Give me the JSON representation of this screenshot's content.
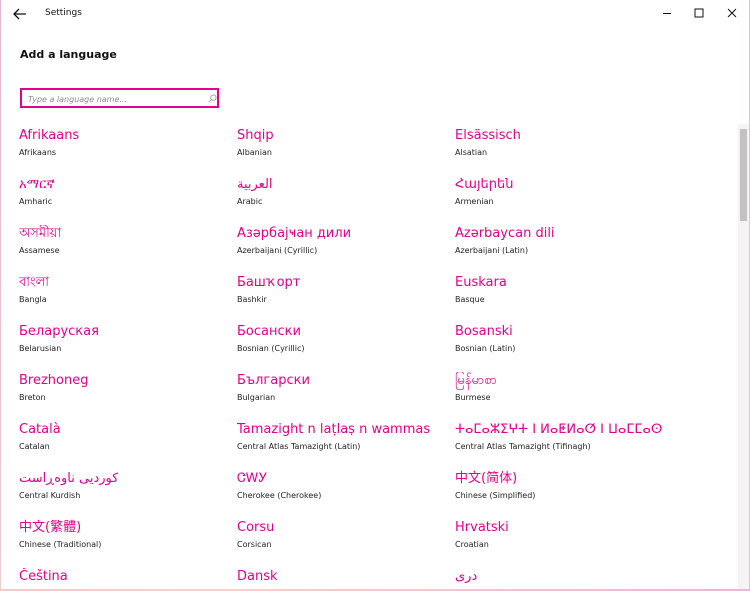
{
  "window": {
    "title": "Settings"
  },
  "page": {
    "title": "Add a language"
  },
  "search": {
    "placeholder": "Type a language name..."
  },
  "languages": [
    {
      "native": "Afrikaans",
      "english": "Afrikaans"
    },
    {
      "native": "Shqip",
      "english": "Albanian"
    },
    {
      "native": "Elsässisch",
      "english": "Alsatian"
    },
    {
      "native": "አማርኛ",
      "english": "Amharic"
    },
    {
      "native": "العربية",
      "english": "Arabic"
    },
    {
      "native": "Հայերեն",
      "english": "Armenian"
    },
    {
      "native": "অসমীয়া",
      "english": "Assamese"
    },
    {
      "native": "Азәрбајҹан дили",
      "english": "Azerbaijani (Cyrillic)"
    },
    {
      "native": "Azərbaycan dili",
      "english": "Azerbaijani (Latin)"
    },
    {
      "native": "বাংলা",
      "english": "Bangla"
    },
    {
      "native": "Башҡорт",
      "english": "Bashkir"
    },
    {
      "native": "Euskara",
      "english": "Basque"
    },
    {
      "native": "Беларуская",
      "english": "Belarusian"
    },
    {
      "native": "Босански",
      "english": "Bosnian (Cyrillic)"
    },
    {
      "native": "Bosanski",
      "english": "Bosnian (Latin)"
    },
    {
      "native": "Brezhoneg",
      "english": "Breton"
    },
    {
      "native": "Български",
      "english": "Bulgarian"
    },
    {
      "native": "မြန်မာစာ",
      "english": "Burmese"
    },
    {
      "native": "Català",
      "english": "Catalan"
    },
    {
      "native": "Tamazight n laṭlaṣ n wammas",
      "english": "Central Atlas Tamazight (Latin)"
    },
    {
      "native": "ⵜⴰⵎⴰⵣⵉⵖⵜ ⵏ ⵍⴰⵟⵍⴰⵚ ⵏ ⵡⴰⵎⵎⴰⵙ",
      "english": "Central Atlas Tamazight (Tifinagh)"
    },
    {
      "native": "کوردیی ناوەڕاست",
      "english": "Central Kurdish"
    },
    {
      "native": "ᏣᎳᎩ",
      "english": "Cherokee (Cherokee)"
    },
    {
      "native": "中文(简体)",
      "english": "Chinese (Simplified)"
    },
    {
      "native": "中文(繁體)",
      "english": "Chinese (Traditional)"
    },
    {
      "native": "Corsu",
      "english": "Corsican"
    },
    {
      "native": "Hrvatski",
      "english": "Croatian"
    },
    {
      "native": "Čeština",
      "english": ""
    },
    {
      "native": "Dansk",
      "english": ""
    },
    {
      "native": "دری",
      "english": ""
    }
  ]
}
